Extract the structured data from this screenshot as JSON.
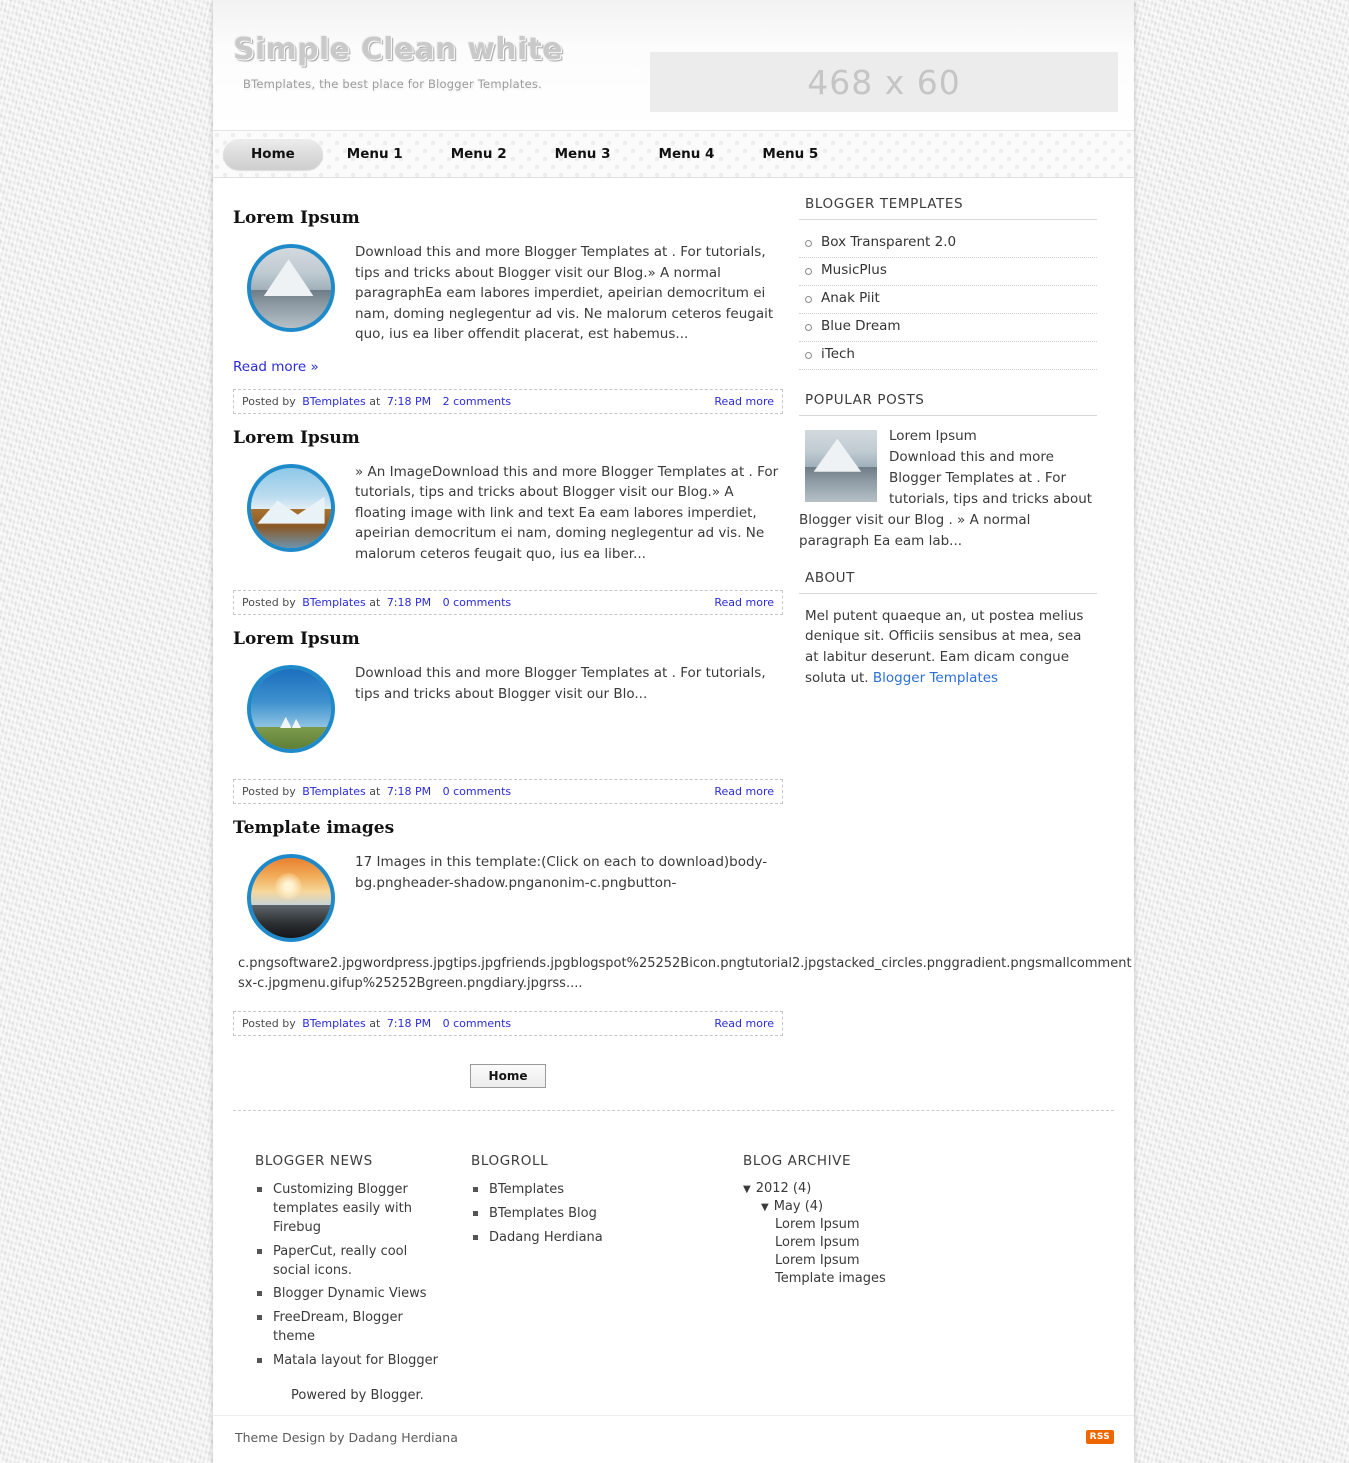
{
  "header": {
    "blog_title": "Simple Clean white",
    "blog_description": "BTemplates, the best place for Blogger Templates.",
    "ad_placeholder": "468 x 60"
  },
  "nav": {
    "items": [
      {
        "label": "Home",
        "active": true
      },
      {
        "label": "Menu 1",
        "active": false
      },
      {
        "label": "Menu 2",
        "active": false
      },
      {
        "label": "Menu 3",
        "active": false
      },
      {
        "label": "Menu 4",
        "active": false
      },
      {
        "label": "Menu 5",
        "active": false
      }
    ]
  },
  "posts": [
    {
      "title": "Lorem Ipsum",
      "text": "Download this and more Blogger Templates at . For tutorials, tips and tricks about Blogger visit our Blog.» A normal paragraphEa eam labores imperdiet, apeirian democritum ei nam, doming neglegentur ad vis. Ne malorum ceteros feugait quo, ius ea liber offendit placerat, est habemus...",
      "read_more_inline": "Read more »",
      "meta_posted_by": "Posted by",
      "meta_author": "BTemplates",
      "meta_at": "at",
      "meta_time": "7:18 PM",
      "meta_comments": "2 comments",
      "meta_read_more": "Read more"
    },
    {
      "title": "Lorem Ipsum",
      "text": "» An ImageDownload this and more Blogger Templates at . For tutorials, tips and tricks about Blogger visit our Blog.» A floating image with link and text Ea eam labores imperdiet, apeirian democritum ei nam, doming neglegentur ad vis. Ne malorum ceteros feugait quo, ius ea liber...",
      "read_more_inline": "",
      "meta_posted_by": "Posted by",
      "meta_author": "BTemplates",
      "meta_at": "at",
      "meta_time": "7:18 PM",
      "meta_comments": "0 comments",
      "meta_read_more": "Read more"
    },
    {
      "title": "Lorem Ipsum",
      "text": "Download this and more Blogger Templates at . For tutorials, tips and tricks about Blogger visit our Blo...",
      "read_more_inline": "",
      "meta_posted_by": "Posted by",
      "meta_author": "BTemplates",
      "meta_at": "at",
      "meta_time": "7:18 PM",
      "meta_comments": "0 comments",
      "meta_read_more": "Read more"
    },
    {
      "title": "Template images",
      "text": "17 Images in this template:(Click on each to download)body-bg.pngheader-shadow.pnganonim-c.pngbutton-",
      "overflow_text": "c.pngsoftware2.jpgwordpress.jpgtips.jpgfriends.jpgblogspot%25252Bicon.pngtutorial2.jpgstacked_circles.pnggradient.pngsmallcommentsx-c.jpgmenu.gifup%25252Bgreen.pngdiary.jpgrss....",
      "read_more_inline": "",
      "meta_posted_by": "Posted by",
      "meta_author": "BTemplates",
      "meta_at": "at",
      "meta_time": "7:18 PM",
      "meta_comments": "0 comments",
      "meta_read_more": "Read more"
    }
  ],
  "pager": {
    "home_button": "Home"
  },
  "sidebar": {
    "templates_heading": "BLOGGER TEMPLATES",
    "templates": [
      "Box Transparent 2.0",
      "MusicPlus",
      "Anak Piit",
      "Blue Dream",
      "iTech"
    ],
    "popular_heading": "POPULAR POSTS",
    "popular_post": {
      "title": "Lorem Ipsum",
      "excerpt": "Download this and more Blogger Templates at . For tutorials, tips and tricks about Blogger visit our Blog . » A normal paragraph Ea eam lab..."
    },
    "about_heading": "ABOUT",
    "about_text": "Mel putent quaeque an, ut postea melius denique sit. Officiis sensibus at mea, sea at labitur deserunt. Eam dicam congue soluta ut. ",
    "about_link": "Blogger Templates"
  },
  "footer": {
    "news_heading": "BLOGGER NEWS",
    "news_items": [
      "Customizing Blogger templates easily with Firebug",
      "PaperCut, really cool social icons.",
      "Blogger Dynamic Views",
      "FreeDream, Blogger theme",
      "Matala layout for Blogger"
    ],
    "powered_by": "Powered by Blogger.",
    "blogroll_heading": "BLOGROLL",
    "blogroll_items": [
      "BTemplates",
      "BTemplates Blog",
      "Dadang Herdiana"
    ],
    "archive_heading": "BLOG ARCHIVE",
    "archive_year": "2012 (4)",
    "archive_month": "May (4)",
    "archive_posts": [
      "Lorem Ipsum",
      "Lorem Ipsum",
      "Lorem Ipsum",
      "Template images"
    ],
    "credit": "Theme Design by Dadang Herdiana",
    "rss_label": "RSS"
  },
  "colors": {
    "accent_blue": "#1f8ac9",
    "link_blue": "#2b2bd8",
    "rss_orange": "#ee6600",
    "page_bg": "#e9e9e9"
  }
}
